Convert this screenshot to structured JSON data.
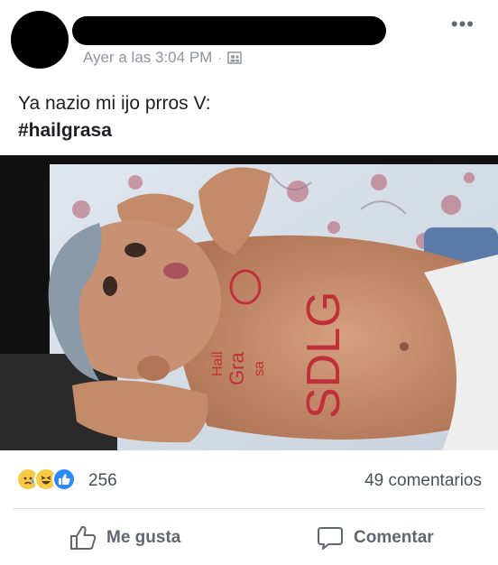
{
  "post": {
    "timestamp": "Ayer a las 3:04 PM",
    "separator": "·",
    "privacy_icon": "friends-icon",
    "more_icon": "•••",
    "text_line1": "Ya nazio mi ijo prros V:",
    "text_line2": "#hailgrasa"
  },
  "photo": {
    "body_writing_line1": "Hail",
    "body_writing_line2": "Gra",
    "body_writing_line3": "sa",
    "body_writing_big": "SDLG"
  },
  "reactions": {
    "icons": [
      "sad-reaction-icon",
      "haha-reaction-icon",
      "like-reaction-icon"
    ],
    "count": "256",
    "comments": "49 comentarios"
  },
  "actions": {
    "like_label": "Me gusta",
    "comment_label": "Comentar"
  },
  "colors": {
    "text": "#1c1e21",
    "meta": "#90949c",
    "like_blue": "#2d88ff",
    "reaction_yellow": "#f7c945",
    "divider": "#dddfe2"
  }
}
